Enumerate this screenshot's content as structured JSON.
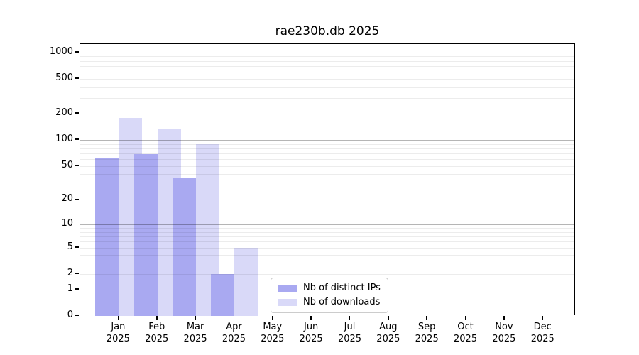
{
  "chart_data": {
    "type": "bar",
    "title": "rae230b.db 2025",
    "categories": [
      "Jan 2025",
      "Feb 2025",
      "Mar 2025",
      "Apr 2025",
      "May 2025",
      "Jun 2025",
      "Jul 2025",
      "Aug 2025",
      "Sep 2025",
      "Oct 2025",
      "Nov 2025",
      "Dec 2025"
    ],
    "series": [
      {
        "name": "Nb of distinct IPs",
        "color": "#a9a9f1",
        "values": [
          62,
          68,
          36,
          2,
          0,
          0,
          0,
          0,
          0,
          0,
          0,
          0
        ]
      },
      {
        "name": "Nb of downloads",
        "color": "#d9d9f8",
        "values": [
          180,
          132,
          90,
          5,
          0,
          0,
          0,
          0,
          0,
          0,
          0,
          0
        ]
      }
    ],
    "xlabel": "",
    "ylabel": "",
    "y_scale": "log1p",
    "y_ticks": [
      0,
      1,
      2,
      5,
      10,
      20,
      50,
      100,
      200,
      500,
      1000
    ],
    "major_grid_values": [
      1,
      10,
      100,
      1000
    ],
    "minor_grid_base": [
      2,
      3,
      4,
      5,
      6,
      7,
      8,
      9
    ],
    "minor_grid_decades": [
      1,
      10,
      100
    ],
    "ylim": [
      0,
      1243
    ],
    "grid": "on",
    "legend": {
      "entries": [
        "Nb of distinct IPs",
        "Nb of downloads"
      ],
      "position": "inside-bottom-center-left"
    },
    "colors": {
      "distinct_ips": "#a9a9f1",
      "downloads": "#d9d9f8",
      "major_grid": "#b3b3b3",
      "minor_grid": "#eaeaea",
      "axis": "#000000",
      "background": "#ffffff"
    }
  }
}
